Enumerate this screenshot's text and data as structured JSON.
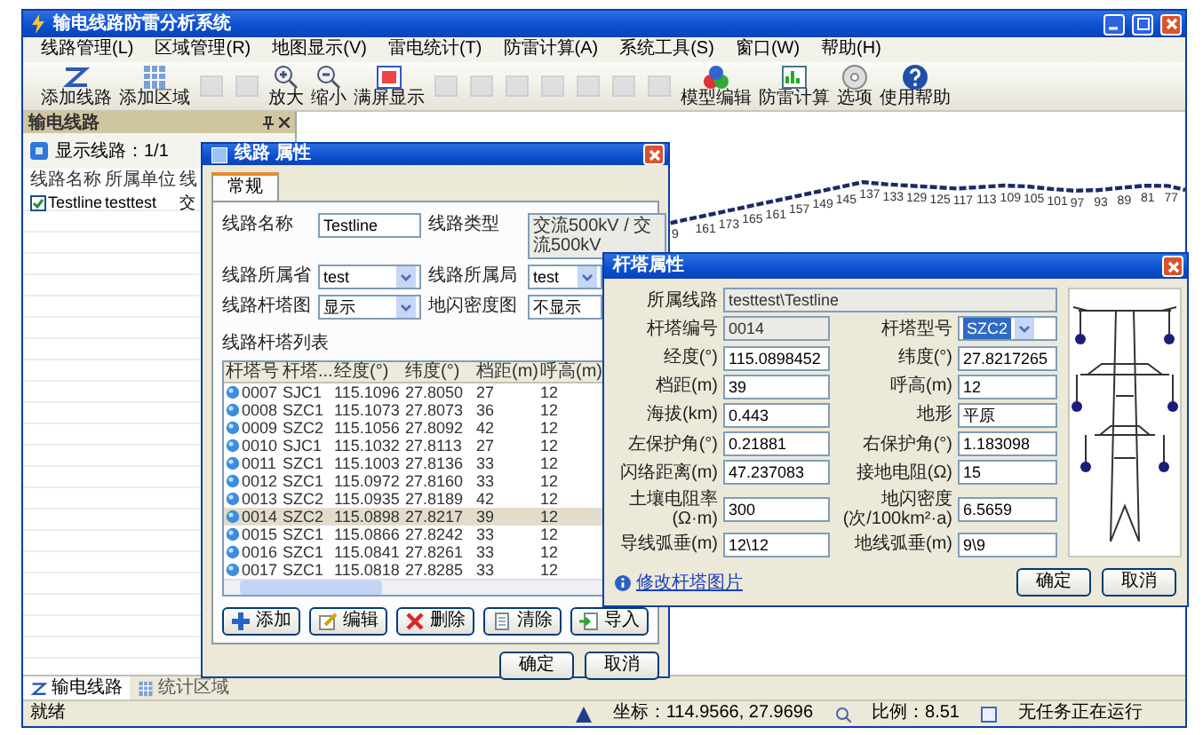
{
  "window": {
    "title": "输电线路防雷分析系统"
  },
  "menu": [
    "线路管理(L)",
    "区域管理(R)",
    "地图显示(V)",
    "雷电统计(T)",
    "防雷计算(A)",
    "系统工具(S)",
    "窗口(W)",
    "帮助(H)"
  ],
  "toolbar": [
    {
      "kind": "add-line",
      "label": "添加线路",
      "disabled": false
    },
    {
      "kind": "add-area",
      "label": "添加区域",
      "disabled": false
    },
    {
      "kind": "generic",
      "disabled": true
    },
    {
      "kind": "generic",
      "disabled": true
    },
    {
      "kind": "zoom-in",
      "label": "放大",
      "disabled": false
    },
    {
      "kind": "zoom-out",
      "label": "缩小",
      "disabled": false
    },
    {
      "kind": "full-extent",
      "label": "满屏显示",
      "disabled": false
    },
    {
      "kind": "generic",
      "disabled": true
    },
    {
      "kind": "generic",
      "disabled": true
    },
    {
      "kind": "generic",
      "disabled": true
    },
    {
      "kind": "generic",
      "disabled": true
    },
    {
      "kind": "generic",
      "disabled": true
    },
    {
      "kind": "generic",
      "disabled": true
    },
    {
      "kind": "generic",
      "disabled": true
    },
    {
      "kind": "model",
      "label": "模型编辑",
      "disabled": false
    },
    {
      "kind": "calc",
      "label": "防雷计算",
      "disabled": false
    },
    {
      "kind": "options",
      "label": "选项",
      "disabled": false
    },
    {
      "kind": "help",
      "label": "使用帮助",
      "disabled": false
    }
  ],
  "left_panel": {
    "title": "输电线路",
    "count_label": "显示线路：1/1",
    "columns": [
      "线路名称",
      "所属单位",
      "线"
    ],
    "rows": [
      {
        "checked": true,
        "cells": [
          "Testline",
          "testtest",
          "交"
        ]
      }
    ]
  },
  "map": {
    "profile_labels": [
      "9",
      "161",
      "173",
      "165",
      "161",
      "157",
      "149",
      "145",
      "137",
      "133",
      "129",
      "125",
      "117",
      "113",
      "109",
      "105",
      "101",
      "97",
      "93",
      "89",
      "81",
      "77"
    ]
  },
  "line_dialog": {
    "title": "线路 属性",
    "tabs": [
      {
        "label": "常规",
        "selected": true
      }
    ],
    "fields": [
      {
        "label": "线路名称",
        "value": "Testline",
        "kind": "text"
      },
      {
        "label": "线路类型",
        "value": "交流500kV / 交流500kV",
        "kind": "readonly"
      },
      {
        "label": "线路所属省",
        "value": "test",
        "kind": "dropdown"
      },
      {
        "label": "线路所属局",
        "value": "test",
        "kind": "dropdown"
      },
      {
        "label": "线路杆塔图",
        "value": "显示",
        "kind": "dropdown"
      },
      {
        "label": "地闪密度图",
        "value": "不显示",
        "kind": "text"
      }
    ],
    "list_title": "线路杆塔列表",
    "columns": [
      "杆塔号",
      "杆塔...",
      "经度(°)",
      "纬度(°)",
      "档距(m)",
      "呼高(m)"
    ],
    "towers": [
      {
        "cells": [
          "0007",
          "SJC1",
          "115.1096",
          "27.8050",
          "27",
          "12"
        ],
        "selected": false
      },
      {
        "cells": [
          "0008",
          "SZC1",
          "115.1073",
          "27.8073",
          "36",
          "12"
        ],
        "selected": false
      },
      {
        "cells": [
          "0009",
          "SZC2",
          "115.1056",
          "27.8092",
          "42",
          "12"
        ],
        "selected": false
      },
      {
        "cells": [
          "0010",
          "SJC1",
          "115.1032",
          "27.8113",
          "27",
          "12"
        ],
        "selected": false
      },
      {
        "cells": [
          "0011",
          "SZC1",
          "115.1003",
          "27.8136",
          "33",
          "12"
        ],
        "selected": false
      },
      {
        "cells": [
          "0012",
          "SZC1",
          "115.0972",
          "27.8160",
          "33",
          "12"
        ],
        "selected": false
      },
      {
        "cells": [
          "0013",
          "SZC2",
          "115.0935",
          "27.8189",
          "42",
          "12"
        ],
        "selected": false
      },
      {
        "cells": [
          "0014",
          "SZC2",
          "115.0898",
          "27.8217",
          "39",
          "12"
        ],
        "selected": true
      },
      {
        "cells": [
          "0015",
          "SZC1",
          "115.0866",
          "27.8242",
          "33",
          "12"
        ],
        "selected": false
      },
      {
        "cells": [
          "0016",
          "SZC1",
          "115.0841",
          "27.8261",
          "33",
          "12"
        ],
        "selected": false
      },
      {
        "cells": [
          "0017",
          "SZC1",
          "115.0818",
          "27.8285",
          "33",
          "12"
        ],
        "selected": false
      }
    ],
    "actions": [
      {
        "kind": "add",
        "label": "添加"
      },
      {
        "kind": "edit",
        "label": "编辑"
      },
      {
        "kind": "delete",
        "label": "删除"
      },
      {
        "kind": "clear",
        "label": "清除"
      },
      {
        "kind": "import",
        "label": "导入"
      }
    ],
    "buttons": [
      "确定",
      "取消"
    ]
  },
  "tower_dialog": {
    "title": "杆塔属性",
    "line_field": {
      "label": "所属线路",
      "value": "testtest\\Testline"
    },
    "fields": [
      {
        "label": "杆塔编号",
        "value": "0014",
        "kind": "readonly"
      },
      {
        "label": "杆塔型号",
        "value": "SZC2",
        "kind": "dropdown"
      },
      {
        "label": "经度(°)",
        "value": "115.0898452",
        "kind": "text"
      },
      {
        "label": "纬度(°)",
        "value": "27.8217265",
        "kind": "text"
      },
      {
        "label": "档距(m)",
        "value": "39",
        "kind": "text"
      },
      {
        "label": "呼高(m)",
        "value": "12",
        "kind": "text"
      },
      {
        "label": "海拔(km)",
        "value": "0.443",
        "kind": "text"
      },
      {
        "label": "地形",
        "value": "平原",
        "kind": "text"
      },
      {
        "label": "左保护角(°)",
        "value": "0.21881",
        "kind": "text"
      },
      {
        "label": "右保护角(°)",
        "value": "1.183098",
        "kind": "text"
      },
      {
        "label": "闪络距离(m)",
        "value": "47.237083",
        "kind": "text"
      },
      {
        "label": "接地电阻(Ω)",
        "value": "15",
        "kind": "text"
      },
      {
        "label": "土壤电阻率(Ω·m)",
        "value": "300",
        "kind": "text"
      },
      {
        "label": "地闪密度(次/100km²·a)",
        "value": "6.5659",
        "kind": "text"
      },
      {
        "label": "导线弧垂(m)",
        "value": "12\\12",
        "kind": "text"
      },
      {
        "label": "地线弧垂(m)",
        "value": "9\\9",
        "kind": "text"
      }
    ],
    "link": "修改杆塔图片",
    "buttons": [
      "确定",
      "取消"
    ]
  },
  "bottom_tabs": [
    {
      "label": "输电线路",
      "selected": true
    },
    {
      "label": "统计区域",
      "selected": false
    }
  ],
  "status_bar": {
    "message": "就绪",
    "coordinates": "坐标：114.9566, 27.9696",
    "scale": "比例：8.51",
    "tasks": "无任务正在运行"
  }
}
